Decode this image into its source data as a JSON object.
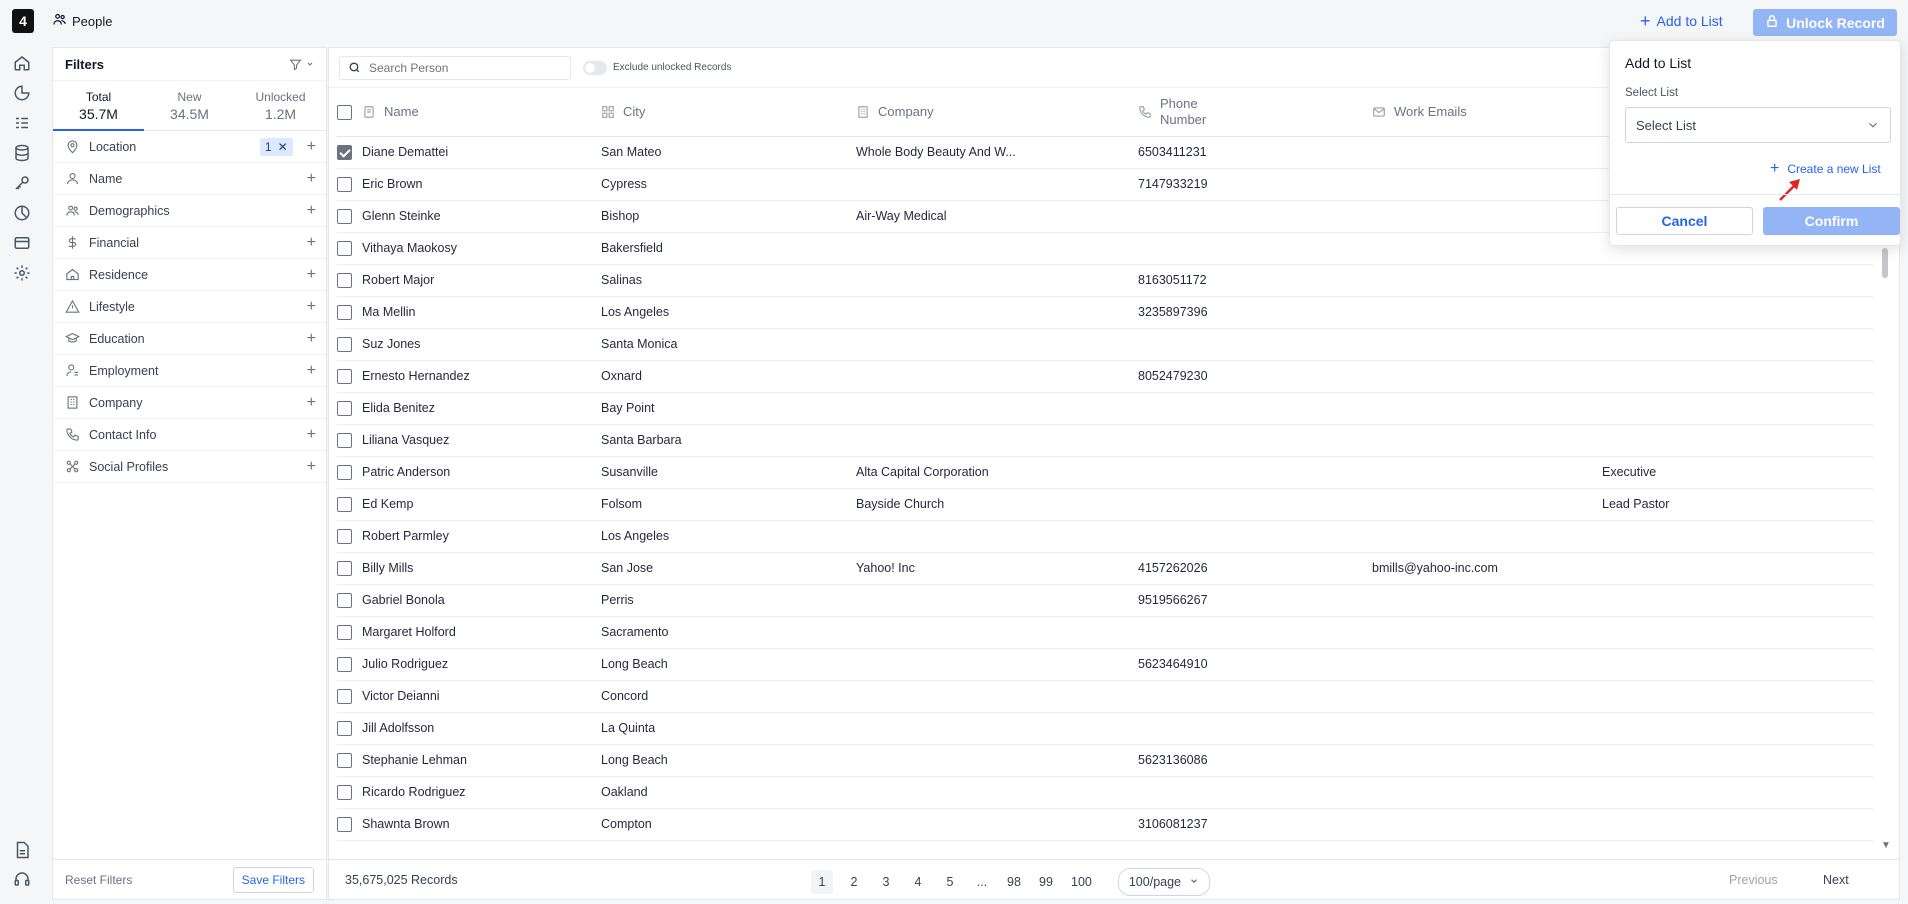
{
  "app": {
    "logo": "4",
    "page_title": "People"
  },
  "header": {
    "add_to_list": "Add to List",
    "unlock_record": "Unlock Record"
  },
  "filters": {
    "title": "Filters",
    "stats": [
      {
        "label": "Total",
        "value": "35.7M"
      },
      {
        "label": "New",
        "value": "34.5M"
      },
      {
        "label": "Unlocked",
        "value": "1.2M"
      }
    ],
    "items": [
      {
        "label": "Location",
        "icon": "location-icon",
        "badge": "1"
      },
      {
        "label": "Name",
        "icon": "person-icon"
      },
      {
        "label": "Demographics",
        "icon": "users-icon"
      },
      {
        "label": "Financial",
        "icon": "dollar-icon"
      },
      {
        "label": "Residence",
        "icon": "home-icon"
      },
      {
        "label": "Lifestyle",
        "icon": "triangle-icon"
      },
      {
        "label": "Education",
        "icon": "graduation-cap-icon"
      },
      {
        "label": "Employment",
        "icon": "employee-icon"
      },
      {
        "label": "Company",
        "icon": "building-icon"
      },
      {
        "label": "Contact Info",
        "icon": "phone-icon"
      },
      {
        "label": "Social Profiles",
        "icon": "share-icon"
      }
    ],
    "reset": "Reset Filters",
    "save": "Save Filters"
  },
  "toolbar": {
    "search_placeholder": "Search Person",
    "exclude_unlocked": "Exclude unlocked Records"
  },
  "table": {
    "columns": [
      "Name",
      "City",
      "Company",
      "Phone Number",
      "Work Emails"
    ],
    "rows": [
      {
        "name": "Diane Demattei",
        "city": "San Mateo",
        "company": "Whole Body Beauty And W...",
        "phone": "6503411231",
        "email": "",
        "title": "",
        "checked": true
      },
      {
        "name": "Eric Brown",
        "city": "Cypress",
        "company": "",
        "phone": "7147933219",
        "email": "",
        "title": ""
      },
      {
        "name": "Glenn Steinke",
        "city": "Bishop",
        "company": "Air-Way Medical",
        "phone": "",
        "email": "",
        "title": ""
      },
      {
        "name": "Vithaya Maokosy",
        "city": "Bakersfield",
        "company": "",
        "phone": "",
        "email": "",
        "title": ""
      },
      {
        "name": "Robert Major",
        "city": "Salinas",
        "company": "",
        "phone": "8163051172",
        "email": "",
        "title": ""
      },
      {
        "name": "Ma Mellin",
        "city": "Los Angeles",
        "company": "",
        "phone": "3235897396",
        "email": "",
        "title": ""
      },
      {
        "name": "Suz Jones",
        "city": "Santa Monica",
        "company": "",
        "phone": "",
        "email": "",
        "title": ""
      },
      {
        "name": "Ernesto Hernandez",
        "city": "Oxnard",
        "company": "",
        "phone": "8052479230",
        "email": "",
        "title": ""
      },
      {
        "name": "Elida Benitez",
        "city": "Bay Point",
        "company": "",
        "phone": "",
        "email": "",
        "title": ""
      },
      {
        "name": "Liliana Vasquez",
        "city": "Santa Barbara",
        "company": "",
        "phone": "",
        "email": "",
        "title": ""
      },
      {
        "name": "Patric Anderson",
        "city": "Susanville",
        "company": "Alta Capital Corporation",
        "phone": "",
        "email": "",
        "title": "Executive"
      },
      {
        "name": "Ed Kemp",
        "city": "Folsom",
        "company": "Bayside Church",
        "phone": "",
        "email": "",
        "title": "Lead Pastor"
      },
      {
        "name": "Robert Parmley",
        "city": "Los Angeles",
        "company": "",
        "phone": "",
        "email": "",
        "title": ""
      },
      {
        "name": "Billy Mills",
        "city": "San Jose",
        "company": "Yahoo! Inc",
        "phone": "4157262026",
        "email": "bmills@yahoo-inc.com",
        "title": ""
      },
      {
        "name": "Gabriel Bonola",
        "city": "Perris",
        "company": "",
        "phone": "9519566267",
        "email": "",
        "title": ""
      },
      {
        "name": "Margaret Holford",
        "city": "Sacramento",
        "company": "",
        "phone": "",
        "email": "",
        "title": ""
      },
      {
        "name": "Julio Rodriguez",
        "city": "Long Beach",
        "company": "",
        "phone": "5623464910",
        "email": "",
        "title": ""
      },
      {
        "name": "Victor Deianni",
        "city": "Concord",
        "company": "",
        "phone": "",
        "email": "",
        "title": ""
      },
      {
        "name": "Jill Adolfsson",
        "city": "La Quinta",
        "company": "",
        "phone": "",
        "email": "",
        "title": ""
      },
      {
        "name": "Stephanie Lehman",
        "city": "Long Beach",
        "company": "",
        "phone": "5623136086",
        "email": "",
        "title": ""
      },
      {
        "name": "Ricardo Rodriguez",
        "city": "Oakland",
        "company": "",
        "phone": "",
        "email": "",
        "title": ""
      },
      {
        "name": "Shawnta Brown",
        "city": "Compton",
        "company": "",
        "phone": "3106081237",
        "email": "",
        "title": ""
      }
    ]
  },
  "footer": {
    "records": "35,675,025 Records",
    "pages": [
      "1",
      "2",
      "3",
      "4",
      "5",
      "...",
      "98",
      "99",
      "100"
    ],
    "active_page": "1",
    "per_page": "100/page",
    "previous": "Previous",
    "next": "Next"
  },
  "popover": {
    "title": "Add to List",
    "select_label": "Select List",
    "select_value": "Select List",
    "create": "Create a new List",
    "cancel": "Cancel",
    "confirm": "Confirm"
  },
  "colors": {
    "accent": "#2563eb",
    "disabled_button": "#93b4f5",
    "arrow": "#dc2626"
  }
}
